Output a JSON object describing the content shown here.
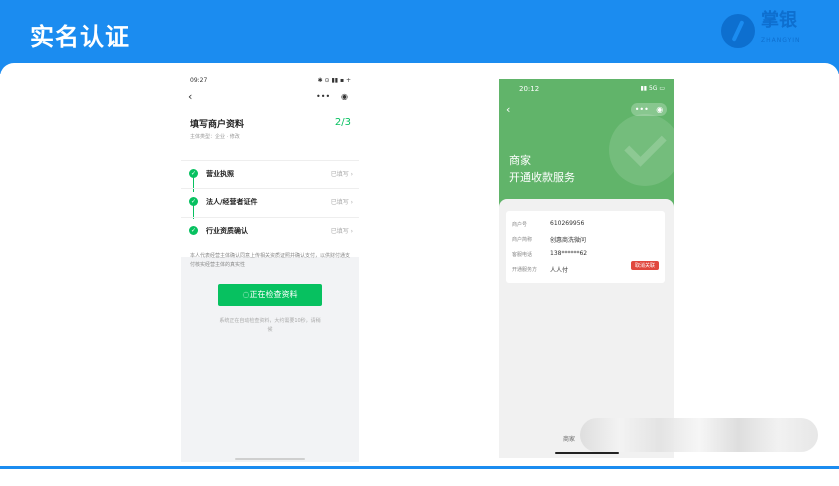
{
  "slide": {
    "title": "实名认证",
    "logo": {
      "name": "掌银",
      "sub": "ZHANGYIN"
    }
  },
  "left_phone": {
    "time": "09:27",
    "status_icons": "✱ ⊙ ▮▮ ▪ +",
    "back": "‹",
    "capsule": [
      "•••",
      "◉"
    ],
    "title": "填写商户资料",
    "step": "2/3",
    "subtitle": "主体类型：企业 · 修改",
    "steps": [
      {
        "label": "营业执照",
        "status": "已填写 ›"
      },
      {
        "label": "法人/经营者证件",
        "status": "已填写 ›"
      },
      {
        "label": "行业资质确认",
        "status": "已填写 ›"
      }
    ],
    "notice": "本人代表经营主体确认同意上传相关资质证照并确认支付，以供财付通支付核实经营主体的真实性",
    "button": "正在检查资料",
    "hint": "系统正在自动检查资料，大约需要10秒，请稍候"
  },
  "right_phone": {
    "time": "20:12",
    "status": "▮▮ 5G ▭",
    "back": "‹",
    "capsule": [
      "•••",
      "◉"
    ],
    "heading1": "商家",
    "heading2": "开通收款服务",
    "rows": [
      {
        "label": "商户号",
        "value": "610269956"
      },
      {
        "label": "商户简称",
        "value": "创惠商洗微问"
      },
      {
        "label": "客服电话",
        "value": "138******62"
      },
      {
        "label": "开通服务方",
        "value": "人人付"
      }
    ],
    "badge": "取消关联",
    "tab": "商家"
  }
}
